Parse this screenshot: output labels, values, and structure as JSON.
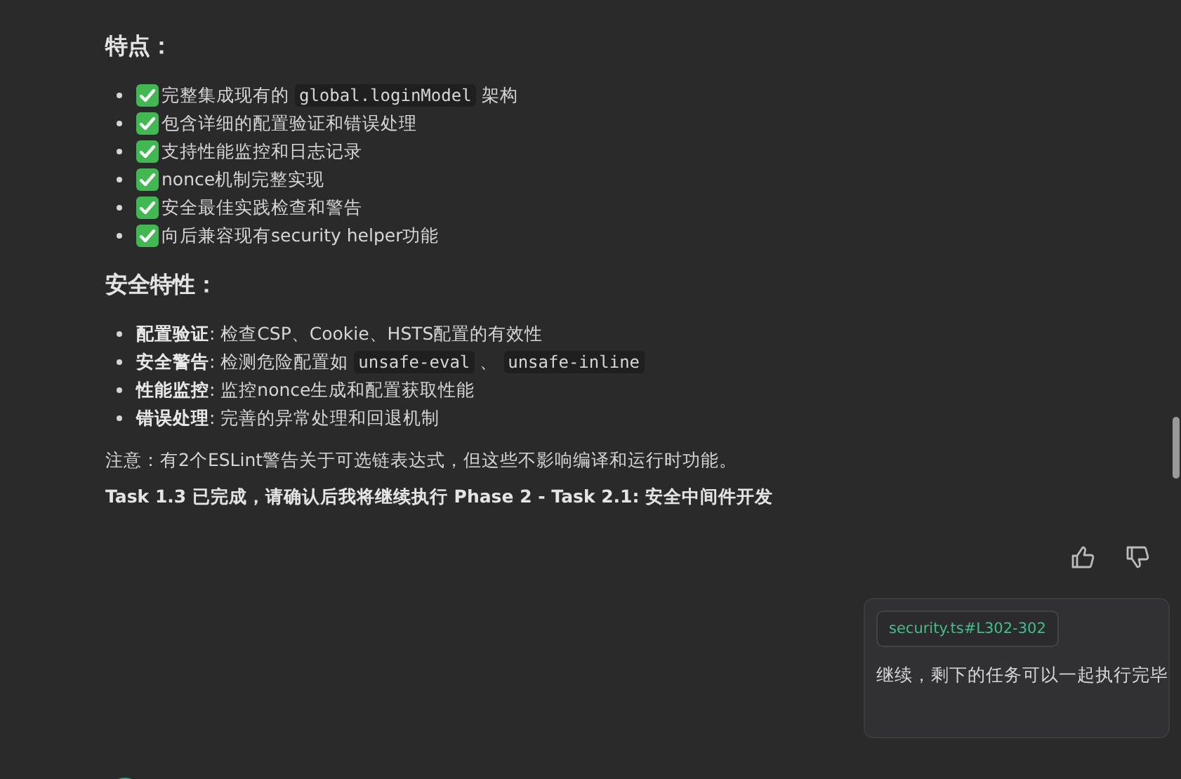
{
  "sections": [
    {
      "heading": "特点：",
      "items": [
        {
          "kind": "check",
          "parts": [
            {
              "kind": "text",
              "text": "完整集成现有的 "
            },
            {
              "kind": "code",
              "text": "global.loginModel"
            },
            {
              "kind": "text",
              "text": " 架构"
            }
          ]
        },
        {
          "kind": "check",
          "parts": [
            {
              "kind": "text",
              "text": "包含详细的配置验证和错误处理"
            }
          ]
        },
        {
          "kind": "check",
          "parts": [
            {
              "kind": "text",
              "text": "支持性能监控和日志记录"
            }
          ]
        },
        {
          "kind": "check",
          "parts": [
            {
              "kind": "text",
              "text": "nonce机制完整实现"
            }
          ]
        },
        {
          "kind": "check",
          "parts": [
            {
              "kind": "text",
              "text": "安全最佳实践检查和警告"
            }
          ]
        },
        {
          "kind": "check",
          "parts": [
            {
              "kind": "text",
              "text": "向后兼容现有security helper功能"
            }
          ]
        }
      ]
    },
    {
      "heading": "安全特性：",
      "items": [
        {
          "kind": "plain",
          "parts": [
            {
              "kind": "bold",
              "text": "配置验证"
            },
            {
              "kind": "text",
              "text": ": 检查CSP、Cookie、HSTS配置的有效性"
            }
          ]
        },
        {
          "kind": "plain",
          "parts": [
            {
              "kind": "bold",
              "text": "安全警告"
            },
            {
              "kind": "text",
              "text": ": 检测危险配置如 "
            },
            {
              "kind": "code",
              "text": "unsafe-eval"
            },
            {
              "kind": "text",
              "text": " 、 "
            },
            {
              "kind": "code",
              "text": "unsafe-inline"
            }
          ]
        },
        {
          "kind": "plain",
          "parts": [
            {
              "kind": "bold",
              "text": "性能监控"
            },
            {
              "kind": "text",
              "text": ": 监控nonce生成和配置获取性能"
            }
          ]
        },
        {
          "kind": "plain",
          "parts": [
            {
              "kind": "bold",
              "text": "错误处理"
            },
            {
              "kind": "text",
              "text": ": 完善的异常处理和回退机制"
            }
          ]
        }
      ]
    }
  ],
  "note": "注意：有2个ESLint警告关于可选链表达式，但这些不影响编译和运行时功能。",
  "conclusion": "Task 1.3 已完成，请确认后我将继续执行 Phase 2 - Task 2.1: 安全中间件开发",
  "user_message": {
    "attachment": "security.ts#L302-302",
    "text": "继续，剩下的任务可以一起执行完毕"
  }
}
